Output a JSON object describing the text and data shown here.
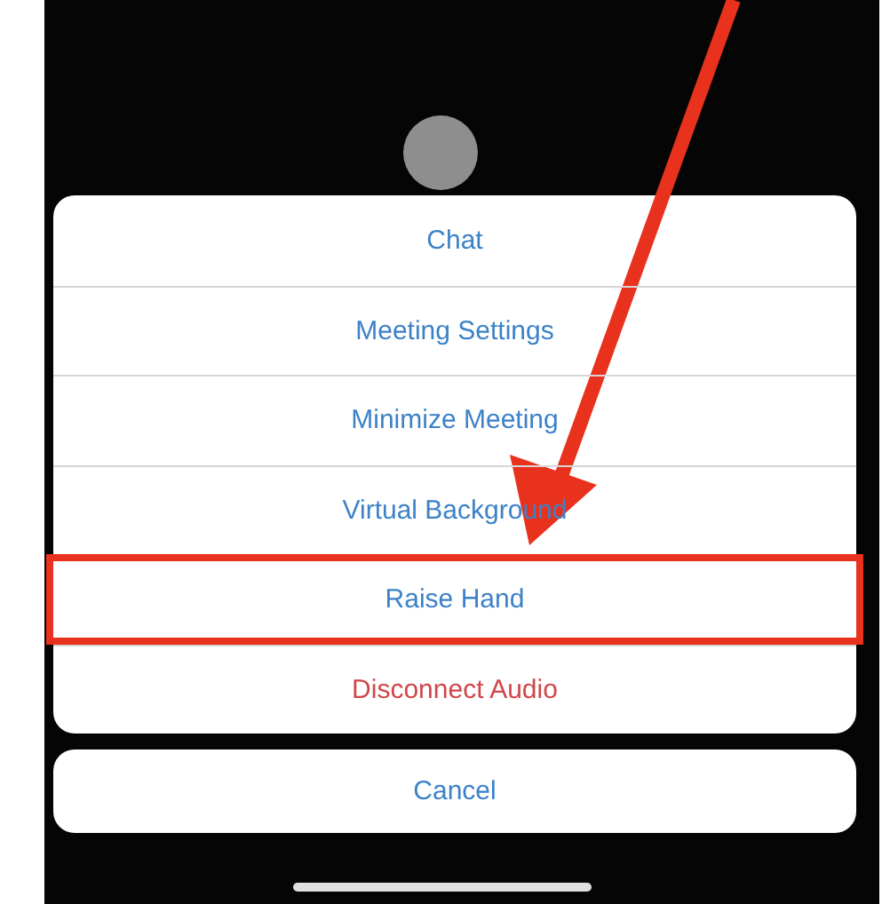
{
  "actions": [
    {
      "label": "Chat",
      "kind": "normal",
      "highlighted": false
    },
    {
      "label": "Meeting Settings",
      "kind": "normal",
      "highlighted": false
    },
    {
      "label": "Minimize Meeting",
      "kind": "normal",
      "highlighted": false
    },
    {
      "label": "Virtual Background",
      "kind": "normal",
      "highlighted": false
    },
    {
      "label": "Raise Hand",
      "kind": "normal",
      "highlighted": true
    },
    {
      "label": "Disconnect Audio",
      "kind": "destructive",
      "highlighted": false
    }
  ],
  "cancel": {
    "label": "Cancel"
  }
}
